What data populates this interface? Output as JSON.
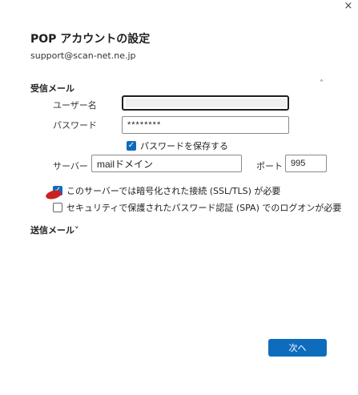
{
  "window": {
    "close_glyph": "×"
  },
  "title": "POP アカウントの設定",
  "email": "support@scan-net.ne.jp",
  "incoming": {
    "header": "受信メール",
    "collapse_glyph": "˄",
    "username_label": "ユーザー名",
    "username_value": "",
    "password_label": "パスワード",
    "password_value": "********",
    "save_password_label": "パスワードを保存する",
    "save_password_checked": true,
    "server_label": "サーバー",
    "server_value": "mailドメイン",
    "port_label": "ポート",
    "port_value": "995",
    "ssl_label": "このサーバーでは暗号化された接続 (SSL/TLS) が必要",
    "ssl_checked": true,
    "spa_label": "セキュリティで保護されたパスワード認証 (SPA) でのログオンが必要",
    "spa_checked": false
  },
  "outgoing": {
    "header": "送信メール˅"
  },
  "actions": {
    "next_label": "次へ"
  },
  "colors": {
    "accent": "#0f6cbd",
    "annotation_red": "#cc1f1f"
  }
}
